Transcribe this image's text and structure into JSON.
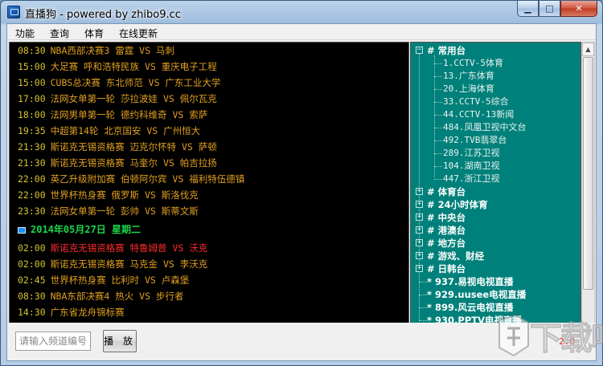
{
  "window": {
    "title": "直播狗 - powered by zhibo9.cc",
    "controls": {
      "minimize": "▁",
      "maximize": "□",
      "close": "✕"
    }
  },
  "menu": [
    "功能",
    "查询",
    "体育",
    "在线更新"
  ],
  "schedule": {
    "rows_before": [
      {
        "time": "08:30",
        "text": "NBA西部决赛3 雷霆 VS 马刺"
      },
      {
        "time": "15:00",
        "text": "大足赛 呼和浩特民族 VS 重庆电子工程"
      },
      {
        "time": "15:00",
        "text": "CUBS总决赛 东北师范 VS 广东工业大学"
      },
      {
        "time": "17:00",
        "text": "法网女单第一轮 莎拉波娃 VS 佩尔瓦克"
      },
      {
        "time": "18:00",
        "text": "法网男单第一轮 德约科维奇 VS 索萨"
      },
      {
        "time": "19:35",
        "text": "中超第14轮 北京国安 VS 广州恒大"
      },
      {
        "time": "21:30",
        "text": "斯诺克无锡资格赛 迈克尔怀特 VS 萨顿"
      },
      {
        "time": "21:30",
        "text": "斯诺克无锡资格赛 马奎尔 VS 帕吉拉扬"
      },
      {
        "time": "22:00",
        "text": "英乙升级附加赛 伯顿阿尔宾 VS 福利特伍德镇"
      },
      {
        "time": "22:00",
        "text": "世界杯热身赛 俄罗斯 VS 斯洛伐克"
      },
      {
        "time": "23:30",
        "text": "法网女单第一轮 彭帅 VS 斯蒂文斯"
      }
    ],
    "date_header": "2014年05月27日 星期二",
    "rows_after": [
      {
        "time": "02:00",
        "text": "斯诺克无锡资格赛 特鲁姆普 VS 沃克",
        "live": true
      },
      {
        "time": "02:00",
        "text": "斯诺克无锡资格赛 马克金 VS 李沃克",
        "live": false
      },
      {
        "time": "02:45",
        "text": "世界杯热身赛 比利时 VS 卢森堡",
        "live": false
      },
      {
        "time": "08:30",
        "text": "NBA东部决赛4 热火 VS 步行者",
        "live": false
      },
      {
        "time": "14:30",
        "text": "广东省龙舟锦标赛",
        "live": false
      }
    ]
  },
  "channels": {
    "expanded_group": "# 常用台",
    "expanded_items": [
      "1.CCTV-5体育",
      "13.广东体育",
      "20.上海体育",
      "33.CCTV-5综合",
      "44.CCTV-13新闻",
      "484.凤凰卫视中文台",
      "492.TVB翡翠台",
      "289.江苏卫视",
      "104.湖南卫视",
      "447.浙江卫视"
    ],
    "collapsed_groups": [
      "# 体育台",
      "# 24小时体育",
      "# 中央台",
      "# 港澳台",
      "# 地方台",
      "# 游戏、财经",
      "# 日韩台"
    ],
    "direct_items": [
      "* 937.易视电视直播",
      "* 929.uusee电视直播",
      "* 899.风云电视直播",
      "* 930.PPTV电视直播"
    ]
  },
  "bottom": {
    "input_placeholder": "请输入频道编号",
    "play_label": "播 放",
    "version": "2.0"
  },
  "watermark": "下载吧",
  "colors": {
    "schedule_bg": "#000000",
    "time": "#d6c22c",
    "event": "#e0a020",
    "live_event": "#ff2a2a",
    "date": "#19d64a",
    "channel_bg": "#00807a"
  }
}
